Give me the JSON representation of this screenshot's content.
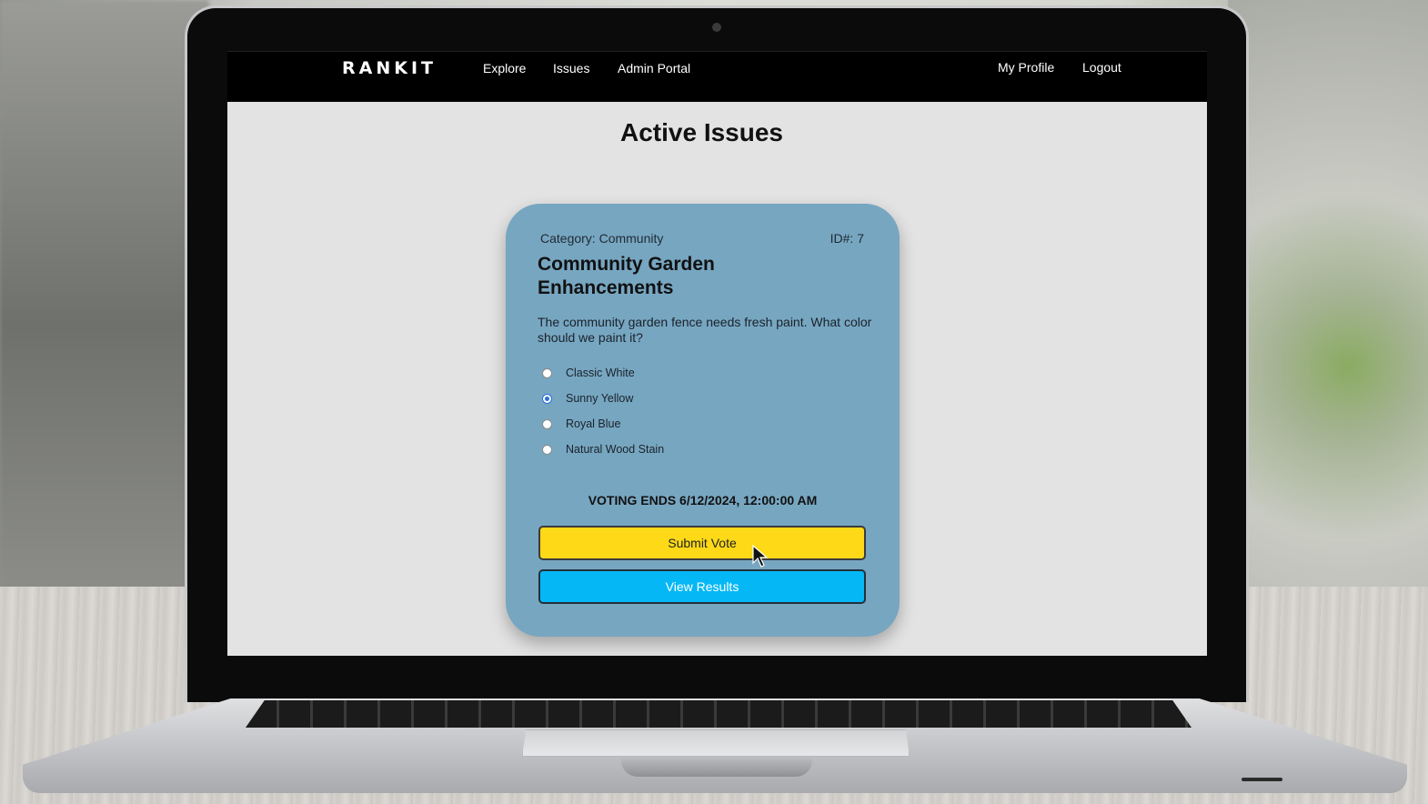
{
  "nav": {
    "logo": "RANKIT",
    "links": {
      "explore": "Explore",
      "issues": "Issues",
      "admin": "Admin Portal"
    },
    "right": {
      "profile": "My Profile",
      "logout": "Logout"
    }
  },
  "page": {
    "title": "Active Issues"
  },
  "issue": {
    "category": "Category: Community",
    "id": "ID#: 7",
    "title": "Community Garden Enhancements",
    "description": "The community garden fence needs fresh paint. What color should we paint it?",
    "options": [
      "Classic White",
      "Sunny Yellow",
      "Royal Blue",
      "Natural Wood Stain"
    ],
    "selected_option": "Sunny Yellow",
    "voting_ends": "VOTING ENDS 6/12/2024, 12:00:00 AM",
    "submit_label": "Submit Vote",
    "results_label": "View Results"
  },
  "colors": {
    "card": "#77a6c1",
    "submit_button": "#fdd918",
    "results_button": "#05b8f5",
    "navbar": "#000000",
    "page_background": "#e3e3e3"
  }
}
